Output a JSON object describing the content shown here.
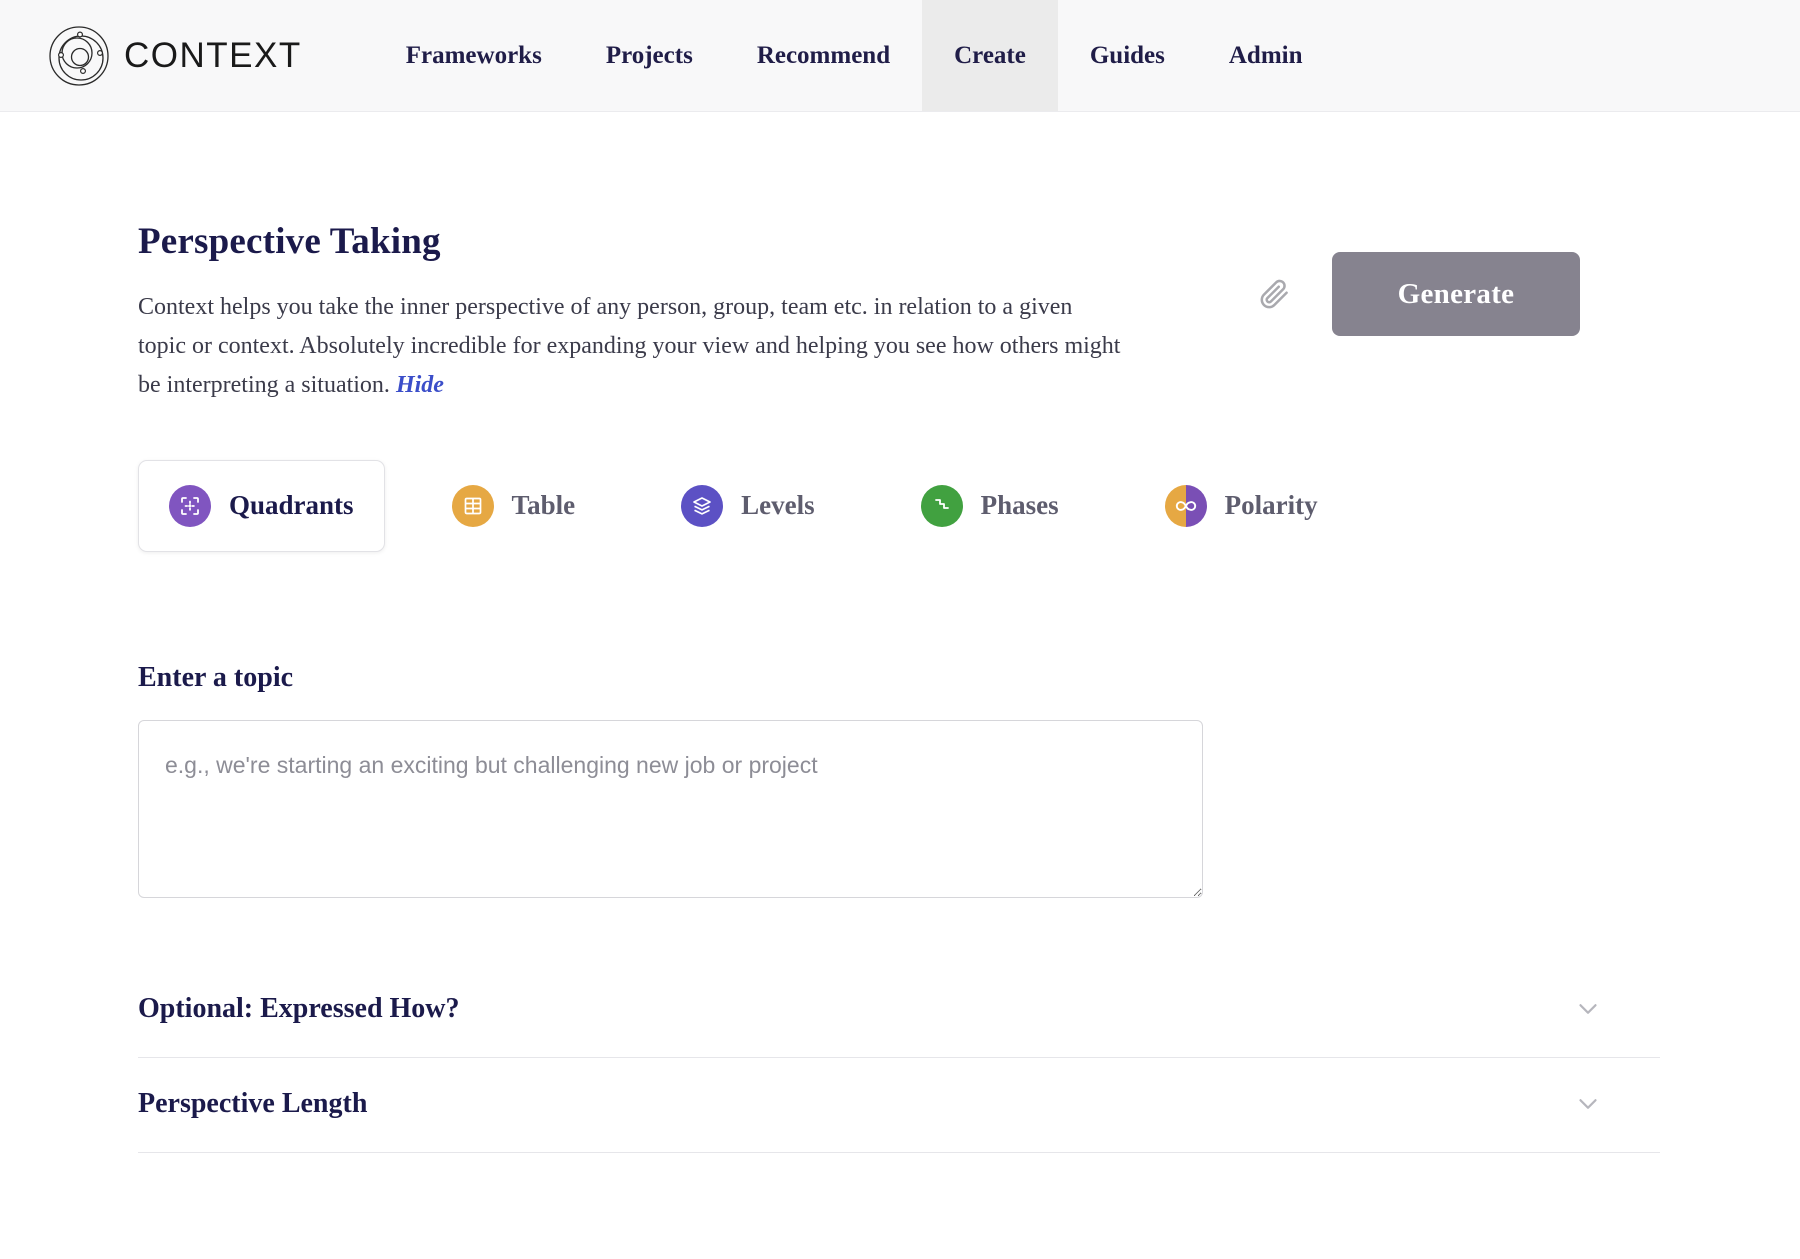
{
  "header": {
    "brand_name": "CONTEXT",
    "logo_icon": "orbit-circles-logo",
    "nav": [
      {
        "label": "Frameworks",
        "active": false
      },
      {
        "label": "Projects",
        "active": false
      },
      {
        "label": "Recommend",
        "active": false
      },
      {
        "label": "Create",
        "active": true
      },
      {
        "label": "Guides",
        "active": false
      },
      {
        "label": "Admin",
        "active": false
      }
    ]
  },
  "main": {
    "title": "Perspective Taking",
    "description": "Context helps you take the inner perspective of any person, group, team etc. in relation to a given topic or context. Absolutely incredible for expanding your view and helping you see how others might be interpreting a situation.",
    "hide_label": "Hide",
    "attach_icon": "paperclip-icon",
    "generate_label": "Generate",
    "tabs": [
      {
        "label": "Quadrants",
        "icon": "quadrants-icon",
        "color": "#8055c0",
        "active": true
      },
      {
        "label": "Table",
        "icon": "table-icon",
        "color": "#e6a843",
        "active": false
      },
      {
        "label": "Levels",
        "icon": "levels-icon",
        "color": "#5c51c4",
        "active": false
      },
      {
        "label": "Phases",
        "icon": "phases-icon",
        "color": "#41a140",
        "active": false
      },
      {
        "label": "Polarity",
        "icon": "polarity-icon",
        "color_left": "#e6a843",
        "color_right": "#7a4fb5",
        "active": false
      }
    ],
    "topic": {
      "label": "Enter a topic",
      "value": "",
      "placeholder": "e.g., we're starting an exciting but challenging new job or project"
    },
    "accordions": [
      {
        "title": "Optional: Expressed How?",
        "icon": "chevron-down-icon",
        "expanded": false
      },
      {
        "title": "Perspective Length",
        "icon": "chevron-down-icon",
        "expanded": false
      }
    ]
  },
  "colors": {
    "brand_navy": "#1b1a4b",
    "link_blue": "#3b4ec9",
    "button_gray": "#86838f",
    "header_bg": "#f8f8f9"
  }
}
